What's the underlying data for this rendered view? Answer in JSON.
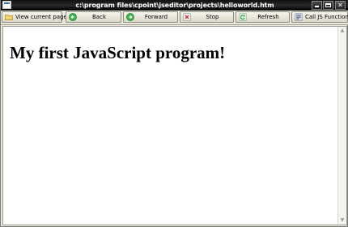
{
  "window": {
    "title": "c:\\program files\\cpoint\\jseditor\\projects\\helloworld.htm",
    "minimize_icon": "minimize-icon",
    "maximize_icon": "maximize-icon",
    "close_icon": "close-icon",
    "close_symbol": "✕"
  },
  "toolbar": {
    "buttons": [
      {
        "label": "View current page",
        "icon": "folder-icon"
      },
      {
        "label": "Back",
        "icon": "back-arrow-icon"
      },
      {
        "label": "Forward",
        "icon": "forward-arrow-icon"
      },
      {
        "label": "Stop",
        "icon": "stop-icon"
      },
      {
        "label": "Refresh",
        "icon": "refresh-icon"
      },
      {
        "label": "Call JS Function",
        "icon": "function-icon"
      }
    ]
  },
  "content": {
    "heading": "My first JavaScript program!"
  },
  "colors": {
    "titlebar": "#000000",
    "toolbar": "#ece9d8",
    "green_nav": "#3bb34a",
    "stop_red": "#cc2a2a",
    "page_bg": "#ffffff"
  }
}
